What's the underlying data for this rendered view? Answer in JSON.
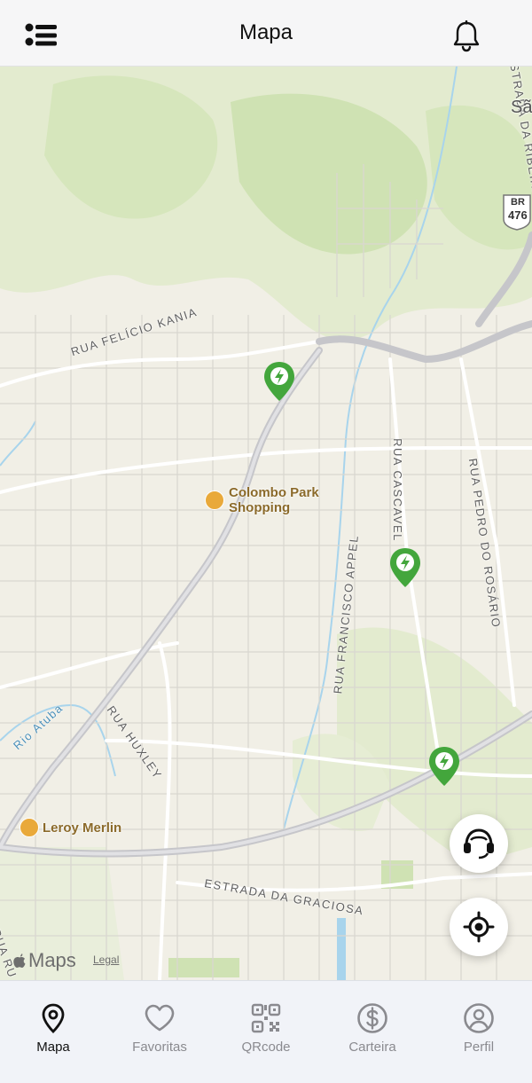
{
  "header": {
    "title": "Mapa",
    "menu_icon": "list-icon",
    "bell_icon": "bell-icon"
  },
  "map": {
    "street_labels": {
      "felicio_kania": "RUA FELÍCIO KANIA",
      "cascavel": "RUA CASCAVEL",
      "pedro_rosario": "RUA PEDRO DO ROSÁRIO",
      "francisco_appel": "RUA FRANCISCO APPEL",
      "huxley": "RUA HUXLEY",
      "graciosa": "ESTRADA DA GRACIOSA",
      "ribeira": "ESTRADA DA RIBEIRA",
      "rio_atuba": "Rio Atuba",
      "rua_ru": "RUA RU",
      "sa": "Sã",
      "br_route": "BR",
      "br_number": "476"
    },
    "pois": {
      "colombo_line1": "Colombo Park",
      "colombo_line2": "Shopping",
      "leroy": "Leroy Merlin"
    },
    "charging_pins": [
      "charging-station-pin",
      "charging-station-pin",
      "charging-station-pin"
    ],
    "attribution": {
      "logo_text": "Maps",
      "legal": "Legal"
    }
  },
  "fabs": {
    "support_icon": "headset-icon",
    "locate_icon": "crosshair-icon"
  },
  "tabs": [
    {
      "label": "Mapa",
      "icon": "map-pin-icon",
      "active": true
    },
    {
      "label": "Favoritas",
      "icon": "heart-icon",
      "active": false
    },
    {
      "label": "QRcode",
      "icon": "qrcode-icon",
      "active": false
    },
    {
      "label": "Carteira",
      "icon": "dollar-icon",
      "active": false
    },
    {
      "label": "Perfil",
      "icon": "user-icon",
      "active": false
    }
  ],
  "colors": {
    "accent_green": "#43a63c",
    "map_land": "#f1efe6",
    "map_park": "#d9e7c0",
    "map_road": "#ffffff",
    "map_highway": "#c8c8cc",
    "active_tab": "#111111",
    "inactive_tab": "#8a8a8f"
  }
}
